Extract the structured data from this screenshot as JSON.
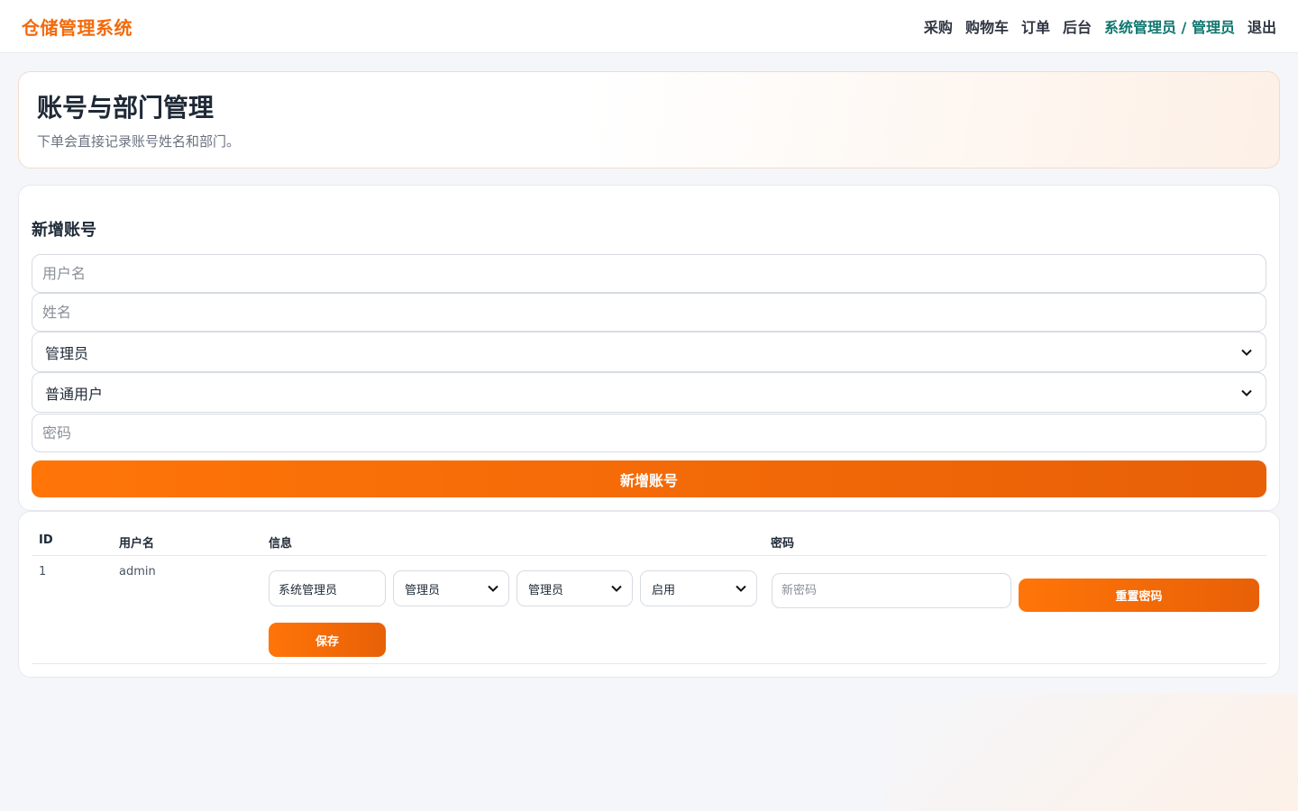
{
  "header": {
    "brand": "仓储管理系统",
    "nav": [
      "采购",
      "购物车",
      "订单",
      "后台"
    ],
    "user": "系统管理员 / 管理员",
    "logout": "退出"
  },
  "hero": {
    "title": "账号与部门管理",
    "subtitle": "下单会直接记录账号姓名和部门。"
  },
  "form": {
    "title": "新增账号",
    "username_placeholder": "用户名",
    "name_placeholder": "姓名",
    "department_selected": "管理员",
    "role_selected": "普通用户",
    "password_placeholder": "密码",
    "submit_label": "新增账号"
  },
  "table": {
    "columns": [
      "ID",
      "用户名",
      "信息",
      "密码"
    ],
    "rows": [
      {
        "id": "1",
        "username": "admin",
        "name_value": "系统管理员",
        "department": "管理员",
        "role": "管理员",
        "status": "启用",
        "save_label": "保存",
        "new_password_placeholder": "新密码",
        "reset_label": "重置密码"
      }
    ]
  },
  "colors": {
    "accent": "#f46a0a",
    "user_link": "#0f766e"
  }
}
